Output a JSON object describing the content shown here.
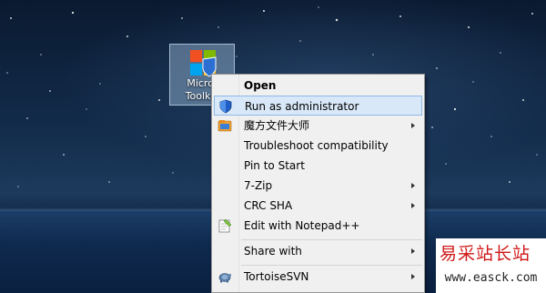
{
  "desktop": {
    "icon": {
      "label_line1": "Micros",
      "label_line2": "Toolkit.",
      "logo": "microsoft-windows-logo-with-shield"
    }
  },
  "context_menu": {
    "items": [
      {
        "label": "Open",
        "icon": null,
        "submenu": false,
        "bold": true
      },
      {
        "label": "Run as administrator",
        "icon": "uac-shield-icon",
        "submenu": false,
        "highlighted": true
      },
      {
        "label": "魔方文件大师",
        "icon": "file-master-icon",
        "submenu": true
      },
      {
        "label": "Troubleshoot compatibility",
        "icon": null,
        "submenu": false
      },
      {
        "label": "Pin to Start",
        "icon": null,
        "submenu": false
      },
      {
        "label": "7-Zip",
        "icon": null,
        "submenu": true
      },
      {
        "label": "CRC SHA",
        "icon": null,
        "submenu": true
      },
      {
        "label": "Edit with Notepad++",
        "icon": "notepadpp-icon",
        "submenu": false
      },
      {
        "label": "Share with",
        "icon": null,
        "submenu": true
      },
      {
        "label": "TortoiseSVN",
        "icon": "tortoisesvn-icon",
        "submenu": true
      }
    ]
  },
  "watermark": {
    "text_cn": "易采站长站",
    "url": "www.easck.com"
  },
  "colors": {
    "highlight_bg": "#d9e8f8",
    "highlight_border": "#8fb8e8",
    "menu_bg": "#f0f0f0",
    "watermark_red": "#d01818"
  }
}
